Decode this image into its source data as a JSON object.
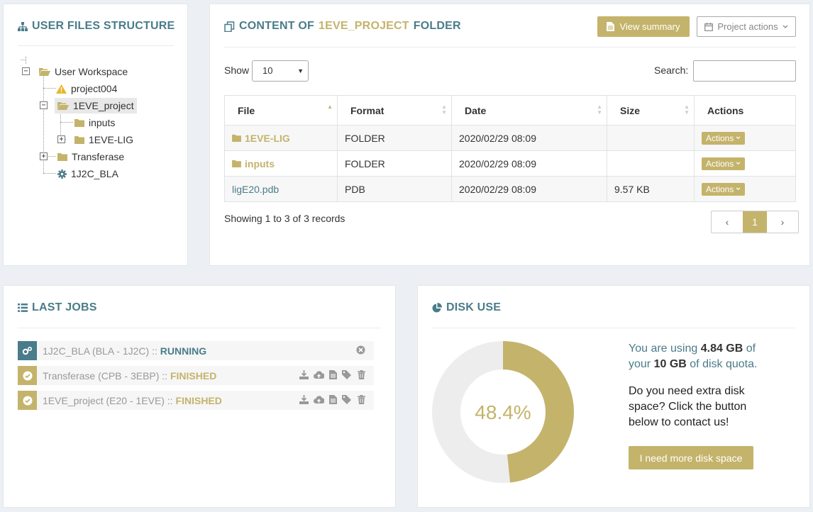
{
  "tree_panel": {
    "title": "USER FILES STRUCTURE",
    "nodes": {
      "workspace": "User Workspace",
      "project004": "project004",
      "eve_project": "1EVE_project",
      "inputs": "inputs",
      "eve_lig": "1EVE-LIG",
      "transferase": "Transferase",
      "bla": "1J2C_BLA"
    }
  },
  "content_panel": {
    "title_prefix": "CONTENT OF",
    "title_folder": "1EVE_PROJECT",
    "title_suffix": "FOLDER",
    "view_summary": "View summary",
    "project_actions": "Project actions",
    "show_label": "Show",
    "show_value": "10",
    "search_label": "Search:",
    "search_value": "",
    "columns": [
      "File",
      "Format",
      "Date",
      "Size",
      "Actions"
    ],
    "rows": [
      {
        "file": "1EVE-LIG",
        "format": "FOLDER",
        "date": "2020/02/29 08:09",
        "size": "",
        "action": "Actions"
      },
      {
        "file": "inputs",
        "format": "FOLDER",
        "date": "2020/02/29 08:09",
        "size": "",
        "action": "Actions"
      },
      {
        "file": "ligE20.pdb",
        "format": "PDB",
        "date": "2020/02/29 08:09",
        "size": "9.57 KB",
        "action": "Actions"
      }
    ],
    "records_info": "Showing 1 to 3 of 3 records",
    "pager": {
      "prev": "‹",
      "current": "1",
      "next": "›"
    }
  },
  "jobs_panel": {
    "title": "LAST JOBS",
    "jobs": [
      {
        "name": "1J2C_BLA (BLA - 1J2C)",
        "sep": " :: ",
        "status": "RUNNING"
      },
      {
        "name": "Transferase (CPB - 3EBP)",
        "sep": " :: ",
        "status": "FINISHED"
      },
      {
        "name": "1EVE_project (E20 - 1EVE)",
        "sep": " :: ",
        "status": "FINISHED"
      }
    ]
  },
  "disk_panel": {
    "title": "DISK USE",
    "percent_label": "48.4%",
    "percent_value": 48.4,
    "usage_pre": "You are using ",
    "used": "4.84 GB",
    "usage_mid": " of",
    "usage_pre2": "your ",
    "quota": "10 GB",
    "usage_post": " of disk quota.",
    "extra_line1": "Do you need extra disk",
    "extra_line2": "space? Click the button",
    "extra_line3": "below to contact us!",
    "button": "I need more disk space"
  },
  "colors": {
    "teal": "#4a7c8a",
    "gold": "#c4b36b",
    "background": "#ecf0f4"
  }
}
